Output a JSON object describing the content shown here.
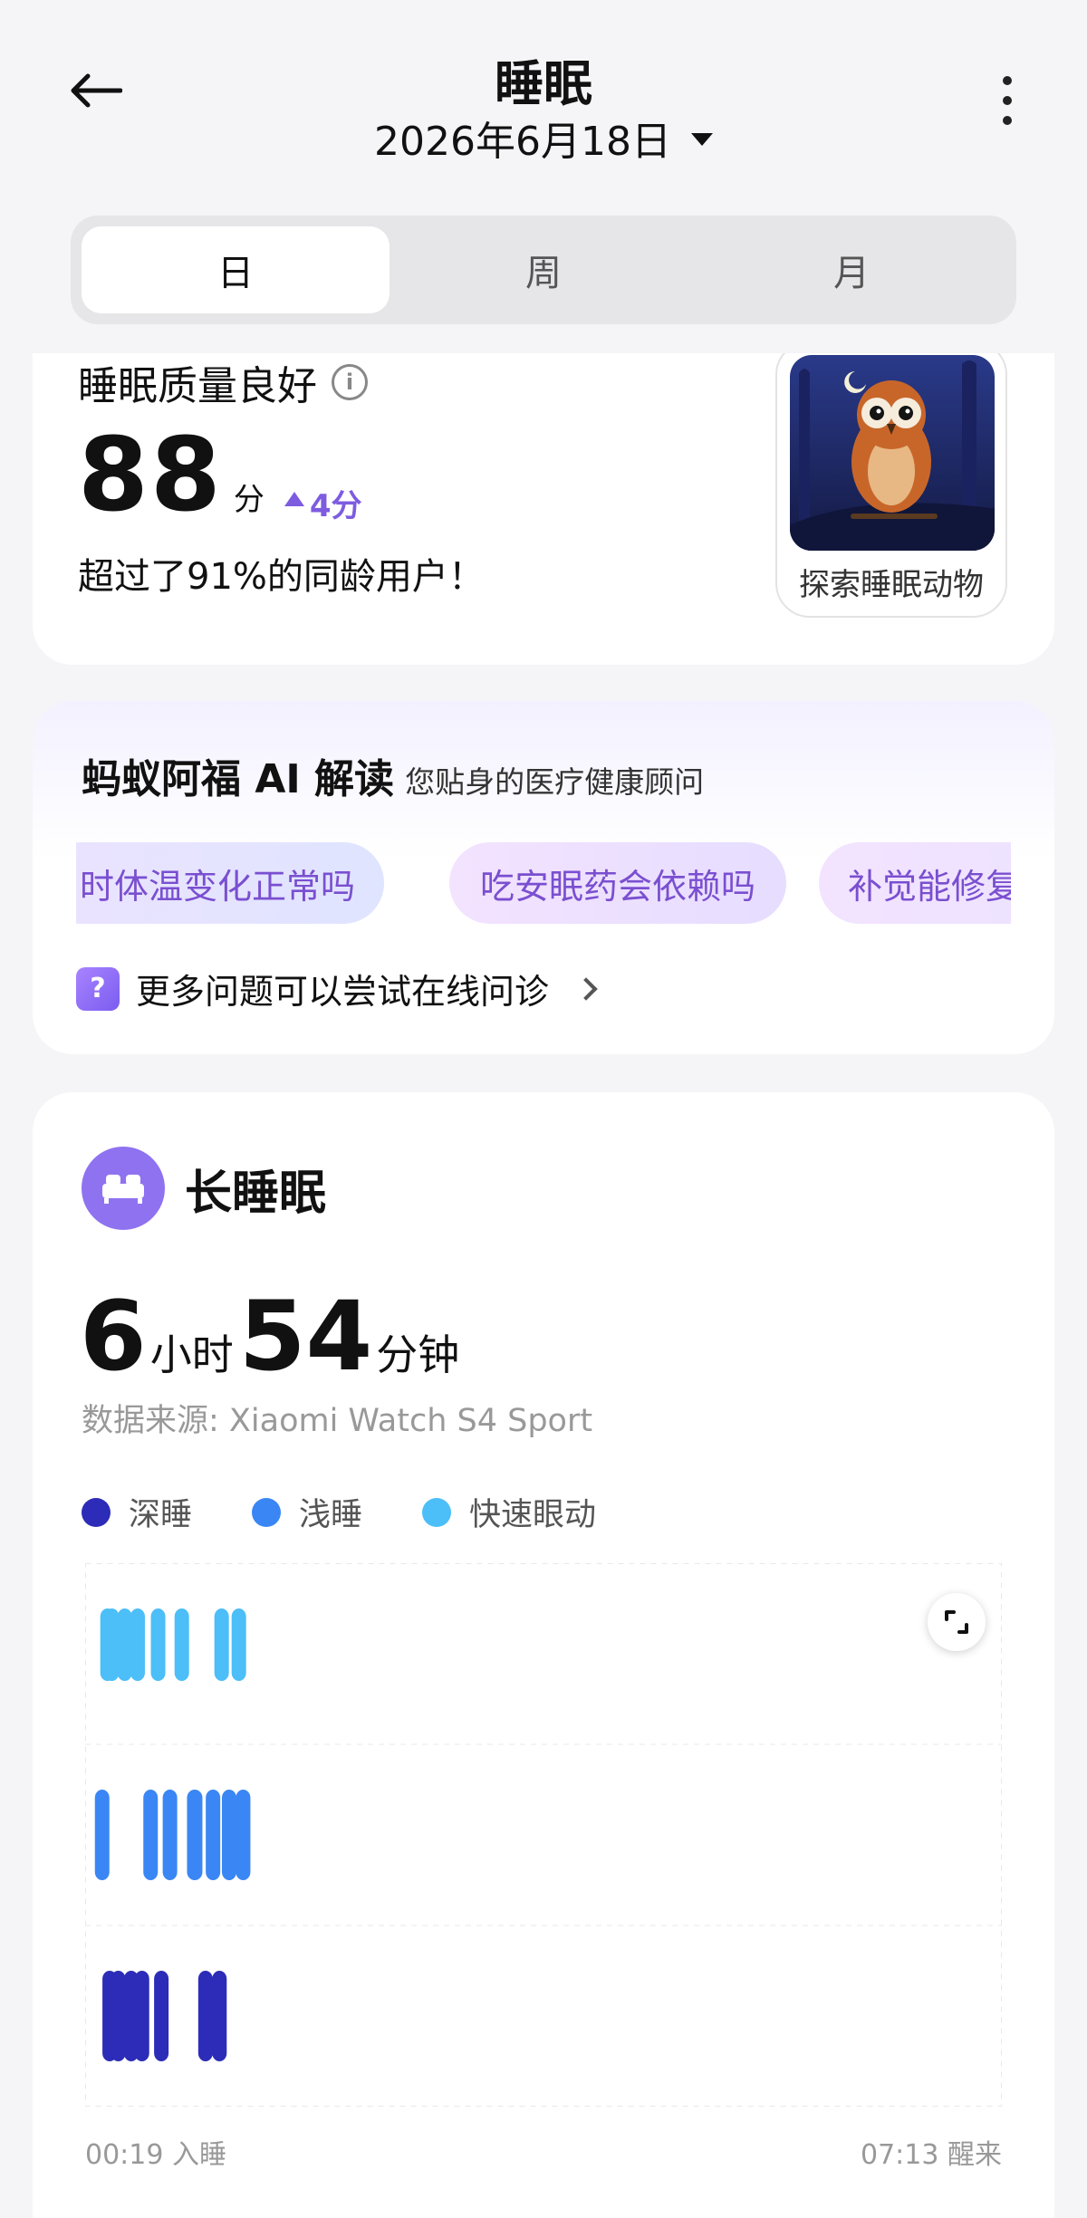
{
  "header": {
    "title": "睡眠",
    "date": "2026年6月18日"
  },
  "tabs": [
    {
      "label": "日",
      "active": true
    },
    {
      "label": "周",
      "active": false
    },
    {
      "label": "月",
      "active": false
    }
  ],
  "score_card": {
    "quality": "睡眠质量良好",
    "score": "88",
    "score_unit": "分",
    "delta": "4分",
    "exceed_text": "超过了91%的同龄用户！",
    "animal_label": "探索睡眠动物"
  },
  "ai_card": {
    "title": "蚂蚁阿福 AI 解读",
    "subtitle": "您贴身的医疗健康顾问",
    "chips": [
      "时体温变化正常吗",
      "吃安眠药会依赖吗",
      "补觉能修复熬"
    ],
    "more_questions": "更多问题可以尝试在线问诊",
    "more_icon": "?"
  },
  "sleep_card": {
    "title": "长睡眠",
    "hours": "6",
    "hours_unit": "小时",
    "minutes": "54",
    "minutes_unit": "分钟",
    "source": "数据来源: Xiaomi Watch S4 Sport",
    "legend": [
      {
        "label": "深睡",
        "color": "#2c2cb8"
      },
      {
        "label": "浅睡",
        "color": "#3a86f5"
      },
      {
        "label": "快速眼动",
        "color": "#4cbef8"
      }
    ],
    "start_label": "00:19 入睡",
    "end_label": "07:13 醒来"
  },
  "chart_data": {
    "type": "hypnogram",
    "start": "00:19",
    "end": "07:13",
    "stages": [
      "快速眼动",
      "浅睡",
      "深睡"
    ],
    "segments": [
      {
        "stage": "浅睡",
        "from": "00:19",
        "to": "00:23"
      },
      {
        "stage": "快速眼动",
        "from": "00:23",
        "to": "00:24"
      },
      {
        "stage": "深睡",
        "from": "00:24",
        "to": "00:25"
      },
      {
        "stage": "快速眼动",
        "from": "00:25",
        "to": "00:26"
      },
      {
        "stage": "深睡",
        "from": "00:26",
        "to": "00:31"
      },
      {
        "stage": "快速眼动",
        "from": "00:31",
        "to": "00:32"
      },
      {
        "stage": "深睡",
        "from": "00:32",
        "to": "00:37"
      },
      {
        "stage": "快速眼动",
        "from": "00:37",
        "to": "00:38"
      },
      {
        "stage": "深睡",
        "from": "00:38",
        "to": "00:41"
      },
      {
        "stage": "浅睡",
        "from": "00:41",
        "to": "00:46"
      },
      {
        "stage": "快速眼动",
        "from": "00:46",
        "to": "00:48"
      },
      {
        "stage": "深睡",
        "from": "00:48",
        "to": "00:49"
      },
      {
        "stage": "浅睡",
        "from": "00:49",
        "to": "00:56"
      },
      {
        "stage": "快速眼动",
        "from": "00:56",
        "to": "01:00"
      },
      {
        "stage": "浅睡",
        "from": "01:00",
        "to": "01:08"
      },
      {
        "stage": "深睡",
        "from": "01:08",
        "to": "01:10"
      },
      {
        "stage": "浅睡",
        "from": "01:10",
        "to": "01:15"
      },
      {
        "stage": "深睡",
        "from": "01:15",
        "to": "01:16"
      },
      {
        "stage": "快速眼动",
        "from": "01:16",
        "to": "01:17"
      },
      {
        "stage": "浅睡",
        "from": "01:17",
        "to": "01:23"
      },
      {
        "stage": "快速眼动",
        "from": "01:23",
        "to": "01:26"
      },
      {
        "stage": "浅睡",
        "from": "01:26",
        "to": "01:27"
      }
    ]
  }
}
